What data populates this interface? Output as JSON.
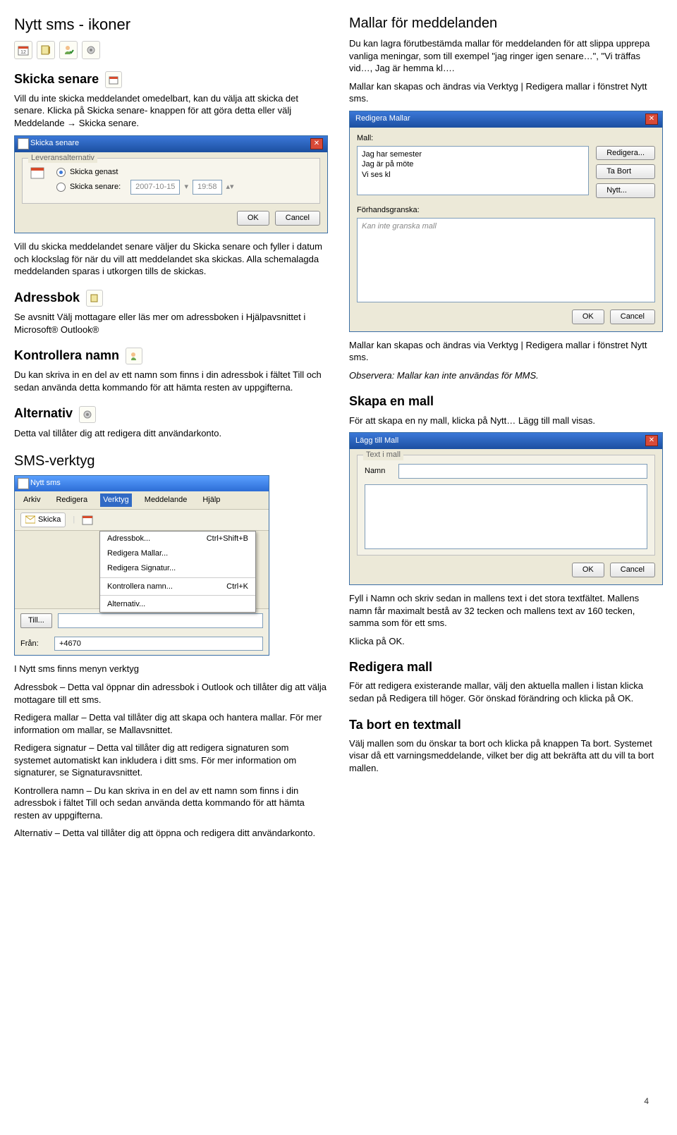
{
  "pageNumber": "4",
  "left": {
    "h1": "Nytt sms - ikoner",
    "skicka": {
      "heading": "Skicka senare",
      "p1": "Vill du inte skicka meddelandet omedelbart, kan du välja att skicka det senare. Klicka på Skicka senare- knappen för att göra detta eller välj Meddelande → Skicka senare."
    },
    "dlgSenare": {
      "title": "Skicka senare",
      "group": "Leveransalternativ",
      "radio1": "Skicka genast",
      "radio2": "Skicka senare:",
      "date": "2007-10-15",
      "time": "19:58",
      "ok": "OK",
      "cancel": "Cancel"
    },
    "afterDlg": "Vill du skicka meddelandet senare väljer du Skicka senare och fyller i datum och klockslag för när du vill att meddelandet ska skickas. Alla schemalagda meddelanden sparas i utkorgen tills de skickas.",
    "adressbok": {
      "heading": "Adressbok",
      "p": "Se avsnitt Välj mottagare eller läs mer om adressboken i Hjälpavsnittet i Microsoft® Outlook®"
    },
    "kontroll": {
      "heading": "Kontrollera namn",
      "p": "Du kan skriva in en del av ett namn som finns i din adressbok i fältet Till och sedan använda detta kommando för att hämta resten av uppgifterna."
    },
    "alternativ": {
      "heading": "Alternativ",
      "p": "Detta val tillåter dig att redigera ditt användarkonto."
    },
    "smsVerktygHeading": "SMS-verktyg",
    "app": {
      "title": "Nytt sms",
      "menu": {
        "arkiv": "Arkiv",
        "redigera": "Redigera",
        "verktyg": "Verktyg",
        "meddelande": "Meddelande",
        "hjalp": "Hjälp"
      },
      "tbSkicka": "Skicka",
      "tillBtn": "Till...",
      "fran": "Från:",
      "franValue": "+4670",
      "dd": {
        "adressbok": "Adressbok...",
        "adressbokKey": "Ctrl+Shift+B",
        "redMallar": "Redigera Mallar...",
        "redSig": "Redigera Signatur...",
        "kontroll": "Kontrollera namn...",
        "kontrollKey": "Ctrl+K",
        "alternativ": "Alternativ..."
      }
    },
    "verktygText": {
      "intro": "I Nytt sms finns menyn verktyg",
      "p1": "Adressbok – Detta val öppnar din adressbok i Outlook och tillåter dig att välja mottagare till ett sms.",
      "p2": "Redigera mallar – Detta val tillåter dig att skapa och hantera mallar. För mer information om mallar, se Mallavsnittet.",
      "p3": "Redigera signatur – Detta val tillåter dig att redigera signaturen som systemet automatiskt kan inkludera i ditt sms. För mer information om signaturer, se Signaturavsnittet.",
      "p4": "Kontrollera namn – Du kan skriva in en del av ett namn som finns i din adressbok i fältet Till och sedan använda detta kommando för att hämta resten av uppgifterna.",
      "p5": "Alternativ – Detta val tillåter dig att öppna och redigera ditt användarkonto."
    }
  },
  "right": {
    "h1": "Mallar för meddelanden",
    "p1": "Du kan lagra förutbestämda mallar för meddelanden för att slippa upprepa vanliga meningar, som till exempel \"jag ringer igen senare…\", \"Vi träffas vid…, Jag är hemma kl….",
    "p2": "Mallar kan skapas och ändras via Verktyg | Redigera mallar i fönstret Nytt sms.",
    "dlgMallar": {
      "title": "Redigera Mallar",
      "mallLabel": "Mall:",
      "items": [
        "Jag har semester",
        "Jag är på möte",
        "Vi ses kl"
      ],
      "btnRed": "Redigera...",
      "btnDel": "Ta Bort",
      "btnNew": "Nytt...",
      "prevLabel": "Förhandsgranska:",
      "prevText": "Kan inte granska mall",
      "ok": "OK",
      "cancel": "Cancel"
    },
    "p3": "Mallar kan skapas och ändras via Verktyg | Redigera mallar i fönstret Nytt sms.",
    "obs": "Observera: Mallar kan inte användas för MMS.",
    "skapa": {
      "heading": "Skapa en mall",
      "p": "För att skapa en ny mall, klicka på Nytt… Lägg till mall visas."
    },
    "dlgAdd": {
      "title": "Lägg till Mall",
      "lbl1": "Text i mall",
      "lbl2": "Namn",
      "ok": "OK",
      "cancel": "Cancel"
    },
    "fillText": "Fyll i Namn och skriv sedan in mallens text i det stora textfältet.  Mallens namn får maximalt bestå av 32 tecken och mallens text av 160 tecken, samma som för ett sms.",
    "klicka": "Klicka på OK.",
    "redigera": {
      "heading": "Redigera mall",
      "p": "För att redigera existerande mallar, välj den aktuella mallen i listan klicka sedan på Redigera till höger. Gör önskad förändring och klicka på OK."
    },
    "tabort": {
      "heading": "Ta bort en textmall",
      "p": "Välj mallen som du önskar ta bort och klicka på knappen Ta bort. Systemet visar då ett varningsmeddelande, vilket ber dig att bekräfta att du vill ta bort mallen."
    }
  }
}
